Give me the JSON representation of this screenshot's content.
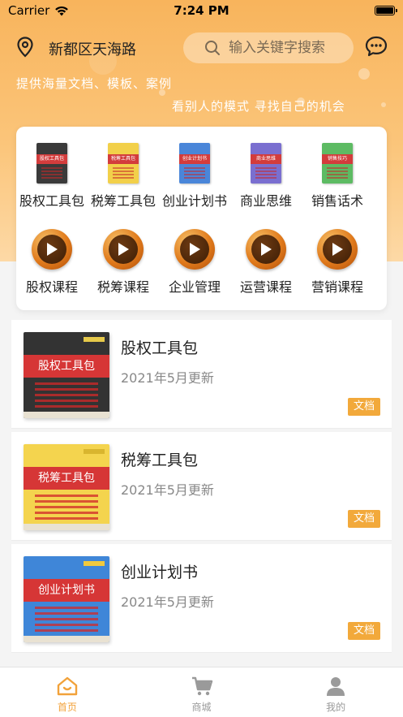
{
  "status_bar": {
    "carrier": "Carrier",
    "time": "7:24 PM"
  },
  "header": {
    "location": "新都区天海路",
    "search_placeholder": "输入关键字搜索",
    "tagline_1": "提供海量文档、模板、案例",
    "tagline_2": "看别人的模式 寻找自己的机会"
  },
  "categories": {
    "documents": [
      {
        "label": "股权工具包",
        "color": "#3a3a3a",
        "band_text": "股权工具包"
      },
      {
        "label": "税筹工具包",
        "color": "#f2d04a",
        "band_text": "税筹工具包"
      },
      {
        "label": "创业计划书",
        "color": "#4a86d9",
        "band_text": "创业计划书"
      },
      {
        "label": "商业思维",
        "color": "#7a6fd0",
        "band_text": "商业思维"
      },
      {
        "label": "销售话术",
        "color": "#5dbb63",
        "band_text": "销售技巧"
      }
    ],
    "courses": [
      {
        "label": "股权课程"
      },
      {
        "label": "税筹课程"
      },
      {
        "label": "企业管理"
      },
      {
        "label": "运营课程"
      },
      {
        "label": "营销课程"
      }
    ]
  },
  "items": [
    {
      "title": "股权工具包",
      "date": "2021年5月更新",
      "badge": "文档",
      "cover_color": "#333333",
      "cover_band": "股权工具包"
    },
    {
      "title": "税筹工具包",
      "date": "2021年5月更新",
      "badge": "文档",
      "cover_color": "#f4d44e",
      "cover_band": "税筹工具包"
    },
    {
      "title": "创业计划书",
      "date": "2021年5月更新",
      "badge": "文档",
      "cover_color": "#3f86d8",
      "cover_band": "创业计划书"
    }
  ],
  "tabs": [
    {
      "label": "首页",
      "icon": "home-icon",
      "active": true
    },
    {
      "label": "商城",
      "icon": "cart-icon",
      "active": false
    },
    {
      "label": "我的",
      "icon": "user-icon",
      "active": false
    }
  ],
  "colors": {
    "accent": "#f2a23a",
    "badge": "#f2a93b"
  }
}
